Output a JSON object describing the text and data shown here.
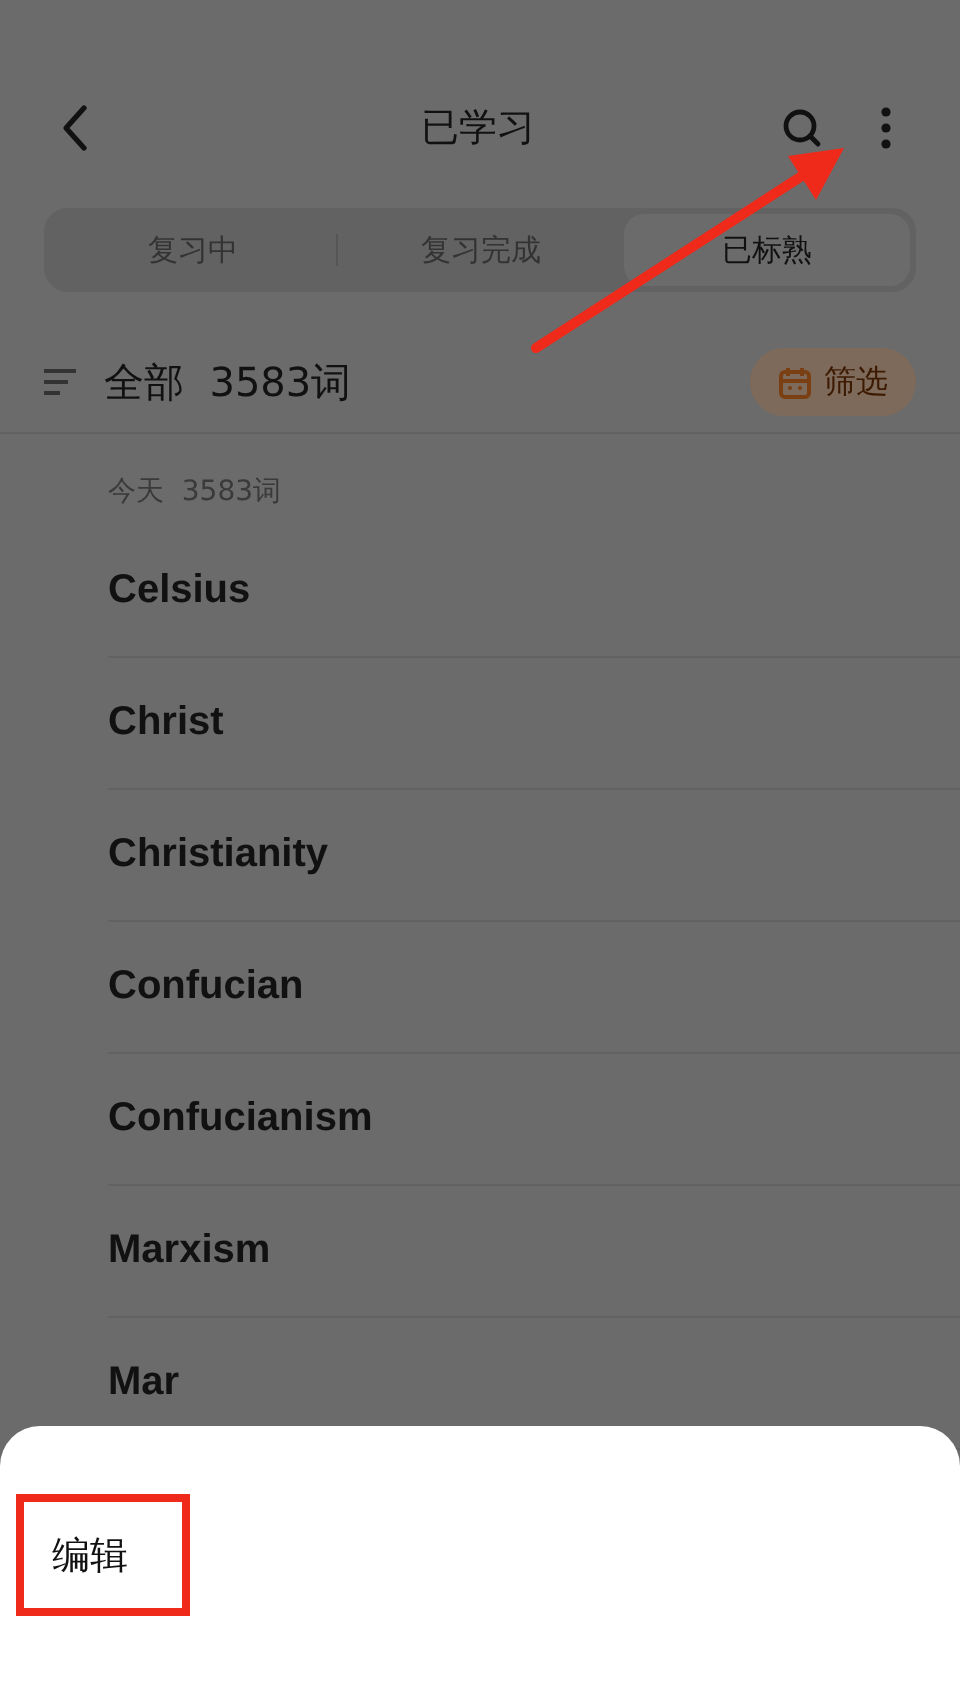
{
  "header": {
    "title": "已学习"
  },
  "tabs": [
    {
      "label": "复习中",
      "selected": false
    },
    {
      "label": "复习完成",
      "selected": false
    },
    {
      "label": "已标熟",
      "selected": true
    }
  ],
  "summary": {
    "label": "全部",
    "count": "3583词",
    "filter_button": "筛选"
  },
  "group": {
    "label": "今天",
    "count": "3583词"
  },
  "words": [
    "Celsius",
    "Christ",
    "Christianity",
    "Confucian",
    "Confucianism",
    "Marxism",
    "Mar"
  ],
  "sheet": {
    "items": [
      {
        "label": "编辑",
        "highlighted": true
      }
    ]
  }
}
